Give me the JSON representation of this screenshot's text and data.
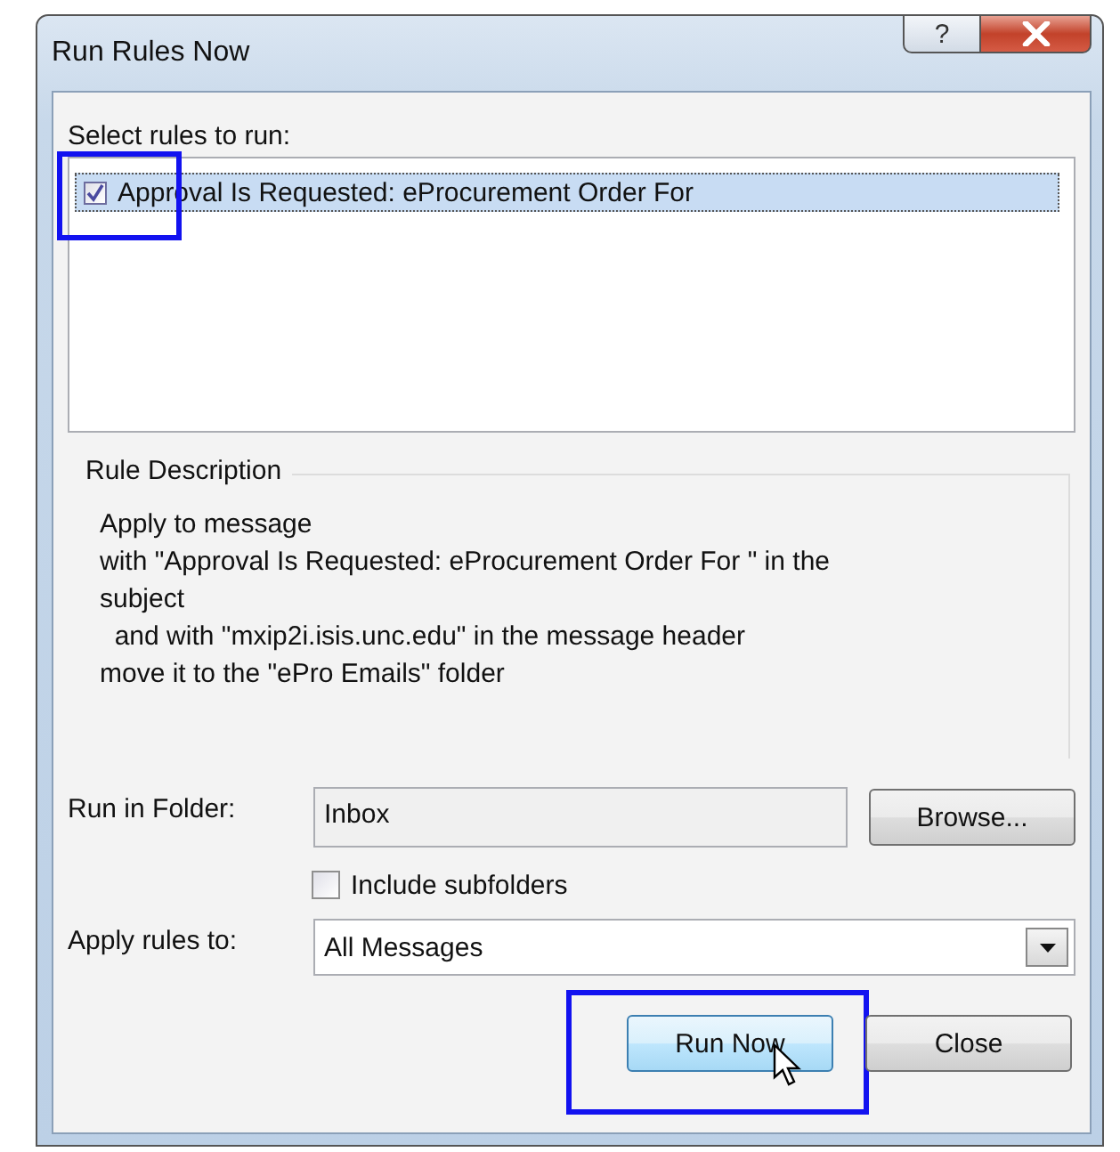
{
  "window": {
    "title": "Run Rules Now",
    "help_button": "?"
  },
  "rules_list": {
    "label": "Select rules to run:",
    "items": [
      {
        "label": "Approval Is Requested: eProcurement Order For",
        "checked": true,
        "selected": true,
        "highlighted": true
      }
    ]
  },
  "rule_description": {
    "title": "Rule Description",
    "lines": [
      "Apply to message",
      "with \"Approval Is Requested: eProcurement Order For \" in the",
      "subject",
      "  and with \"mxip2i.isis.unc.edu\" in the message header",
      "move it to the \"ePro Emails\" folder"
    ]
  },
  "run_in_folder": {
    "label": "Run in Folder:",
    "value": "Inbox",
    "browse_button": "Browse..."
  },
  "include_subfolders": {
    "label": "Include subfolders",
    "checked": false
  },
  "apply_rules_to": {
    "label": "Apply rules to:",
    "value": "All Messages"
  },
  "buttons": [
    {
      "label": "Run Now",
      "hovered": true,
      "highlighted": true
    },
    {
      "label": "Close",
      "hovered": false,
      "highlighted": false
    }
  ]
}
